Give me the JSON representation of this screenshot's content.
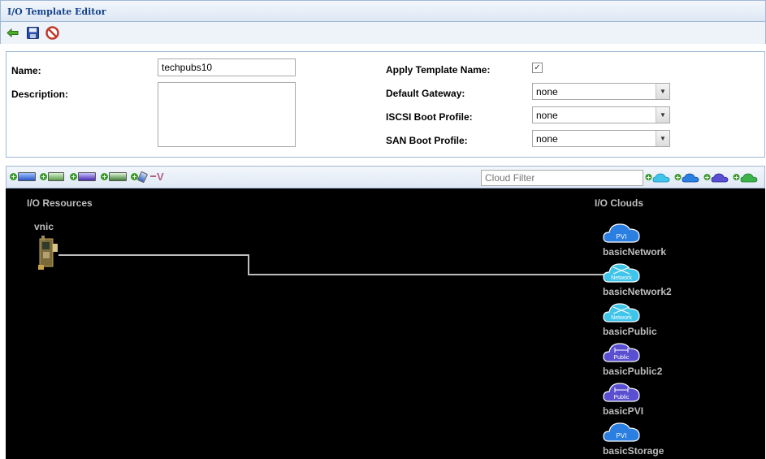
{
  "window": {
    "title": "I/O Template Editor"
  },
  "toolbar": {
    "back_icon": "back-arrow-icon",
    "save_icon": "save-disk-icon",
    "cancel_icon": "cancel-icon"
  },
  "form": {
    "name_label": "Name:",
    "name_value": "techpubs10",
    "description_label": "Description:",
    "description_value": "",
    "apply_template_label": "Apply Template Name:",
    "apply_template_checked": true,
    "default_gateway_label": "Default Gateway:",
    "default_gateway_value": "none",
    "iscsi_boot_label": "ISCSI Boot Profile:",
    "iscsi_boot_value": "none",
    "san_boot_label": "SAN Boot Profile:",
    "san_boot_value": "none"
  },
  "cloud_bar": {
    "filter_placeholder": "Cloud Filter",
    "add_resource_icons": [
      "add-vnic-icon",
      "add-vhba-icon",
      "add-ipsec-icon",
      "add-iscsi-icon",
      "add-storage-icon",
      "remove-icon"
    ],
    "add_cloud_icons": [
      "add-network-cloud-icon",
      "add-pvi-cloud-icon",
      "add-public-cloud-icon",
      "add-storage-cloud-icon"
    ]
  },
  "canvas": {
    "resources_title": "I/O Resources",
    "clouds_title": "I/O Clouds",
    "resources": [
      {
        "label": "vnic"
      }
    ],
    "clouds": [
      {
        "name": "basicNetwork",
        "badge": "PVI",
        "style": "cyan"
      },
      {
        "name": "basicNetwork2",
        "badge": "Network",
        "style": "cyan"
      },
      {
        "name": "basicPublic",
        "badge": "Network",
        "style": "cyan"
      },
      {
        "name": "basicPublic2",
        "badge": "Public",
        "style": "purple"
      },
      {
        "name": "basicPVI",
        "badge": "Public",
        "style": "purple"
      },
      {
        "name": "basicStorage",
        "badge": "PVI",
        "style": "cyan"
      }
    ]
  },
  "colors": {
    "canvas_bg": "#000000",
    "title_text": "#15428b",
    "connector": "#bdbdbd"
  }
}
